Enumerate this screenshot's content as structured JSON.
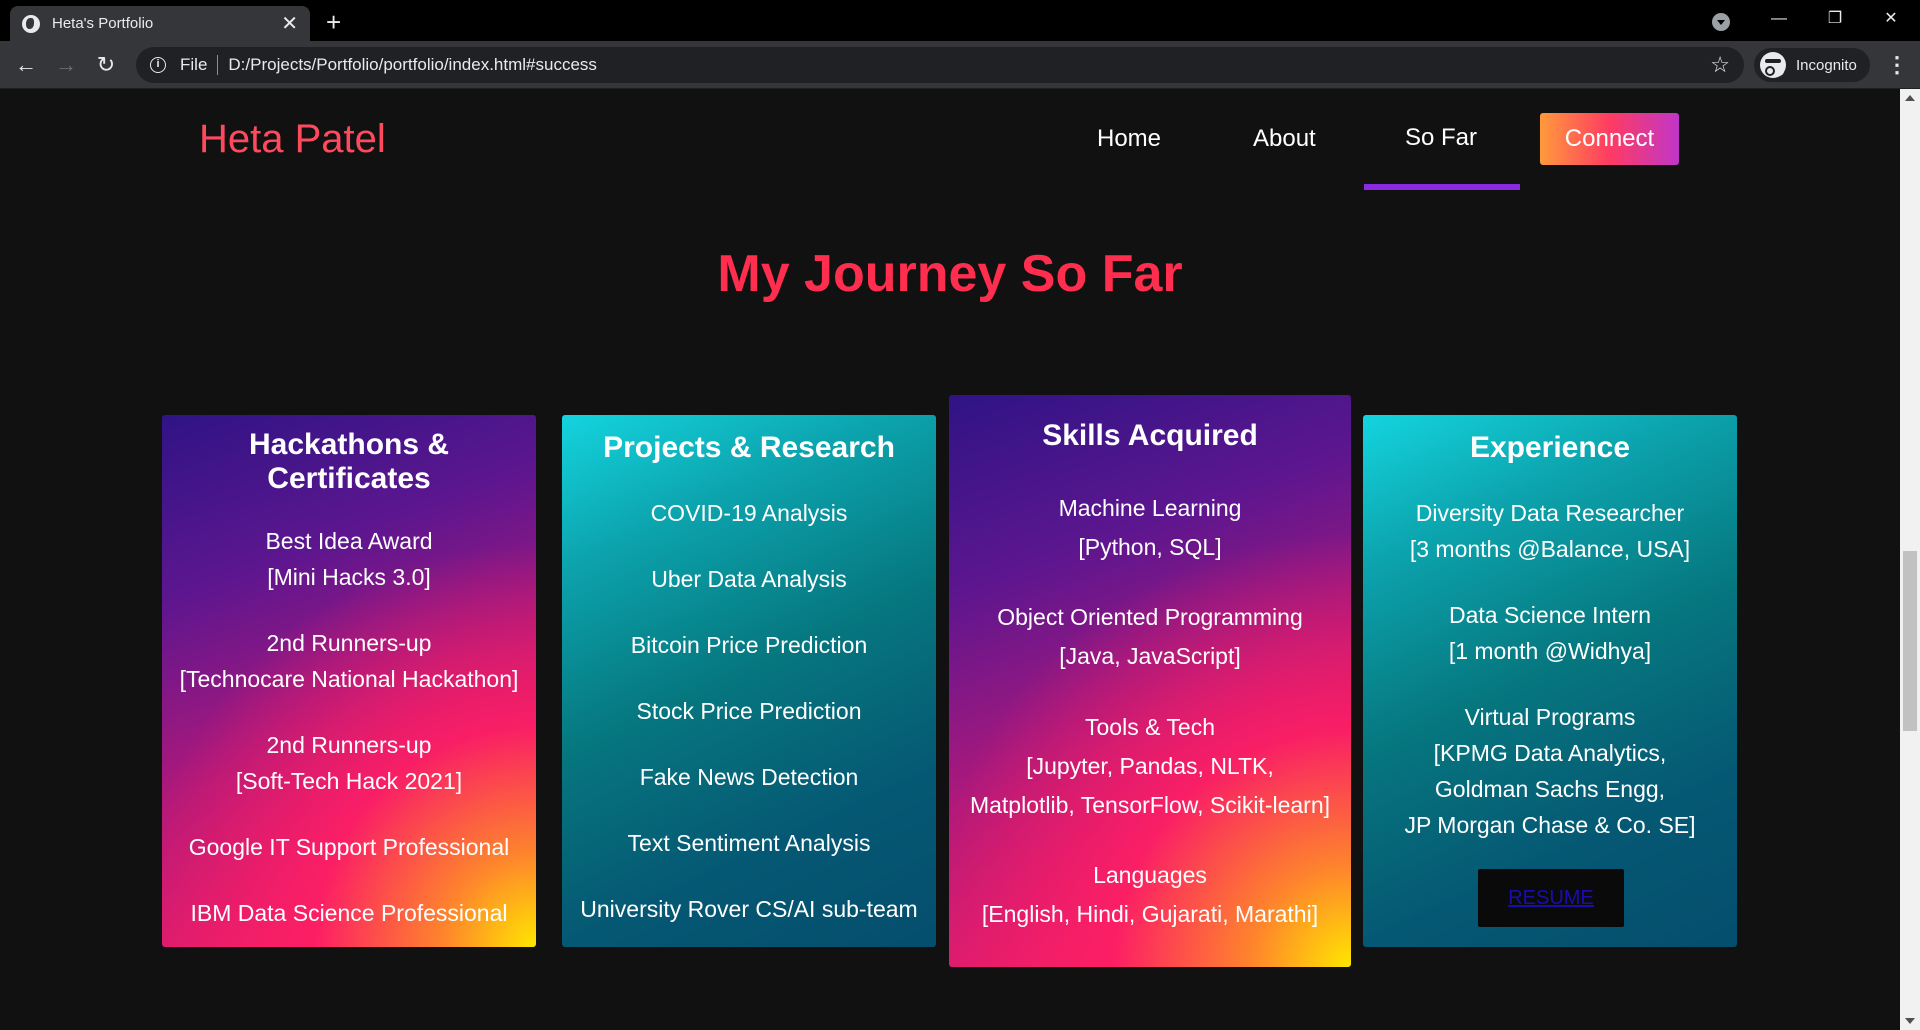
{
  "browser": {
    "tab_title": "Heta's Portfolio",
    "tab_close": "✕",
    "new_tab": "+",
    "url_scheme": "File",
    "url": "D:/Projects/Portfolio/portfolio/index.html#success",
    "profile_label": "Incognito",
    "window_buttons": {
      "minimize": "—",
      "restore": "❐",
      "close": "✕"
    }
  },
  "nav": {
    "brand": "Heta Patel",
    "items": [
      "Home",
      "About",
      "So Far"
    ],
    "active_item": "So Far",
    "connect_label": "Connect"
  },
  "section": {
    "title": "My Journey So Far"
  },
  "cards": {
    "hackathons": {
      "title_line1": "Hackathons &",
      "title_line2": "Certificates",
      "items": [
        {
          "line1": "Best Idea Award",
          "line2": "[Mini Hacks 3.0]"
        },
        {
          "line1": "2nd Runners-up",
          "line2": "[Technocare National Hackathon]"
        },
        {
          "line1": "2nd Runners-up",
          "line2": "[Soft-Tech Hack 2021]"
        },
        {
          "line1": "Google IT Support Professional"
        },
        {
          "line1": "IBM Data Science Professional"
        }
      ]
    },
    "projects": {
      "title": "Projects & Research",
      "items": [
        "COVID-19 Analysis",
        "Uber Data Analysis",
        "Bitcoin Price Prediction",
        "Stock Price Prediction",
        "Fake News Detection",
        "Text Sentiment Analysis",
        "University Rover CS/AI sub-team"
      ]
    },
    "skills": {
      "title": "Skills Acquired",
      "items": [
        {
          "line1": "Machine Learning",
          "line2": "[Python, SQL]"
        },
        {
          "line1": "Object Oriented Programming",
          "line2": "[Java, JavaScript]"
        },
        {
          "line1": "Tools & Tech",
          "line2": "[Jupyter, Pandas, NLTK,",
          "line3": "Matplotlib, TensorFlow, Scikit-learn]"
        },
        {
          "line1": "Languages",
          "line2": "[English, Hindi, Gujarati, Marathi]"
        }
      ]
    },
    "experience": {
      "title": "Experience",
      "items": [
        {
          "line1": "Diversity Data Researcher",
          "line2": "[3 months @Balance, USA]"
        },
        {
          "line1": "Data Science Intern",
          "line2": "[1 month @Widhya]"
        },
        {
          "line1": "Virtual Programs",
          "line2": "[KPMG Data Analytics,",
          "line3": "Goldman Sachs Engg,",
          "line4": "JP Morgan Chase & Co. SE]"
        }
      ],
      "resume_label": "RESUME"
    }
  },
  "colors": {
    "brand": "#ff4a5e",
    "title": "#ff2e4e",
    "active_underline": "#8a2be2"
  }
}
